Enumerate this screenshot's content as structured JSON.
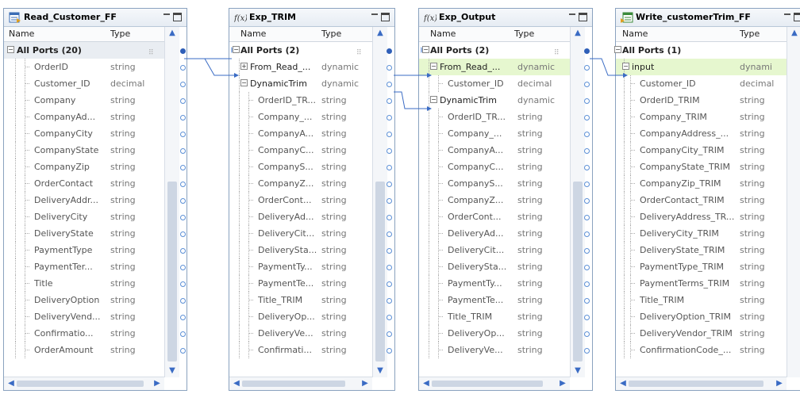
{
  "col_headers": {
    "name": "Name",
    "type": "Type"
  },
  "panels": [
    {
      "id": "read",
      "title": "Read_Customer_FF",
      "icon": "flat-file-source-icon",
      "rows": [
        {
          "name": "All Ports (20)",
          "type": "",
          "kind": "root"
        },
        {
          "name": "OrderID",
          "type": "string"
        },
        {
          "name": "Customer_ID",
          "type": "decimal"
        },
        {
          "name": "Company",
          "type": "string"
        },
        {
          "name": "CompanyAd...",
          "type": "string"
        },
        {
          "name": "CompanyCity",
          "type": "string"
        },
        {
          "name": "CompanyState",
          "type": "string"
        },
        {
          "name": "CompanyZip",
          "type": "string"
        },
        {
          "name": "OrderContact",
          "type": "string"
        },
        {
          "name": "DeliveryAddr...",
          "type": "string"
        },
        {
          "name": "DeliveryCity",
          "type": "string"
        },
        {
          "name": "DeliveryState",
          "type": "string"
        },
        {
          "name": "PaymentType",
          "type": "string"
        },
        {
          "name": "PaymentTer...",
          "type": "string"
        },
        {
          "name": "Title",
          "type": "string"
        },
        {
          "name": "DeliveryOption",
          "type": "string"
        },
        {
          "name": "DeliveryVend...",
          "type": "string"
        },
        {
          "name": "Confirmatio...",
          "type": "string"
        },
        {
          "name": "OrderAmount",
          "type": "string"
        }
      ]
    },
    {
      "id": "trim",
      "title": "Exp_TRIM",
      "icon": "expression-fx-icon",
      "rows": [
        {
          "name": "All Ports (2)",
          "type": "",
          "kind": "root"
        },
        {
          "name": "From_Read_...",
          "type": "dynamic",
          "kind": "group-collapsed"
        },
        {
          "name": "DynamicTrim",
          "type": "dynamic",
          "kind": "group"
        },
        {
          "name": "OrderID_TR...",
          "type": "string"
        },
        {
          "name": "Company_...",
          "type": "string"
        },
        {
          "name": "CompanyA...",
          "type": "string"
        },
        {
          "name": "CompanyC...",
          "type": "string"
        },
        {
          "name": "CompanyS...",
          "type": "string"
        },
        {
          "name": "CompanyZ...",
          "type": "string"
        },
        {
          "name": "OrderCont...",
          "type": "string"
        },
        {
          "name": "DeliveryAd...",
          "type": "string"
        },
        {
          "name": "DeliveryCit...",
          "type": "string"
        },
        {
          "name": "DeliverySta...",
          "type": "string"
        },
        {
          "name": "PaymentTy...",
          "type": "string"
        },
        {
          "name": "PaymentTe...",
          "type": "string"
        },
        {
          "name": "Title_TRIM",
          "type": "string"
        },
        {
          "name": "DeliveryOp...",
          "type": "string"
        },
        {
          "name": "DeliveryVe...",
          "type": "string"
        },
        {
          "name": "Confirmati...",
          "type": "string"
        }
      ]
    },
    {
      "id": "output",
      "title": "Exp_Output",
      "icon": "expression-fx-icon",
      "rows": [
        {
          "name": "All Ports (2)",
          "type": "",
          "kind": "root"
        },
        {
          "name": "From_Read_...",
          "type": "dynamic",
          "kind": "group",
          "hl": true
        },
        {
          "name": "Customer_ID",
          "type": "decimal"
        },
        {
          "name": "DynamicTrim",
          "type": "dynamic",
          "kind": "group"
        },
        {
          "name": "OrderID_TR...",
          "type": "string"
        },
        {
          "name": "Company_...",
          "type": "string"
        },
        {
          "name": "CompanyA...",
          "type": "string"
        },
        {
          "name": "CompanyC...",
          "type": "string"
        },
        {
          "name": "CompanyS...",
          "type": "string"
        },
        {
          "name": "CompanyZ...",
          "type": "string"
        },
        {
          "name": "OrderCont...",
          "type": "string"
        },
        {
          "name": "DeliveryAd...",
          "type": "string"
        },
        {
          "name": "DeliveryCit...",
          "type": "string"
        },
        {
          "name": "DeliverySta...",
          "type": "string"
        },
        {
          "name": "PaymentTy...",
          "type": "string"
        },
        {
          "name": "PaymentTe...",
          "type": "string"
        },
        {
          "name": "Title_TRIM",
          "type": "string"
        },
        {
          "name": "DeliveryOp...",
          "type": "string"
        },
        {
          "name": "DeliveryVe...",
          "type": "string"
        }
      ]
    },
    {
      "id": "write",
      "title": "Write_customerTrim_FF",
      "icon": "flat-file-target-icon",
      "rows": [
        {
          "name": "All Ports (1)",
          "type": "",
          "kind": "root"
        },
        {
          "name": "input",
          "type": "dynami",
          "kind": "group",
          "hl": true
        },
        {
          "name": "Customer_ID",
          "type": "decimal"
        },
        {
          "name": "OrderID_TRIM",
          "type": "string"
        },
        {
          "name": "Company_TRIM",
          "type": "string"
        },
        {
          "name": "CompanyAddress_...",
          "type": "string"
        },
        {
          "name": "CompanyCity_TRIM",
          "type": "string"
        },
        {
          "name": "CompanyState_TRIM",
          "type": "string"
        },
        {
          "name": "CompanyZip_TRIM",
          "type": "string"
        },
        {
          "name": "OrderContact_TRIM",
          "type": "string"
        },
        {
          "name": "DeliveryAddress_TR...",
          "type": "string"
        },
        {
          "name": "DeliveryCity_TRIM",
          "type": "string"
        },
        {
          "name": "DeliveryState_TRIM",
          "type": "string"
        },
        {
          "name": "PaymentType_TRIM",
          "type": "string"
        },
        {
          "name": "PaymentTerms_TRIM",
          "type": "string"
        },
        {
          "name": "Title_TRIM",
          "type": "string"
        },
        {
          "name": "DeliveryOption_TRIM",
          "type": "string"
        },
        {
          "name": "DeliveryVendor_TRIM",
          "type": "string"
        },
        {
          "name": "ConfirmationCode_...",
          "type": "string"
        }
      ]
    }
  ]
}
